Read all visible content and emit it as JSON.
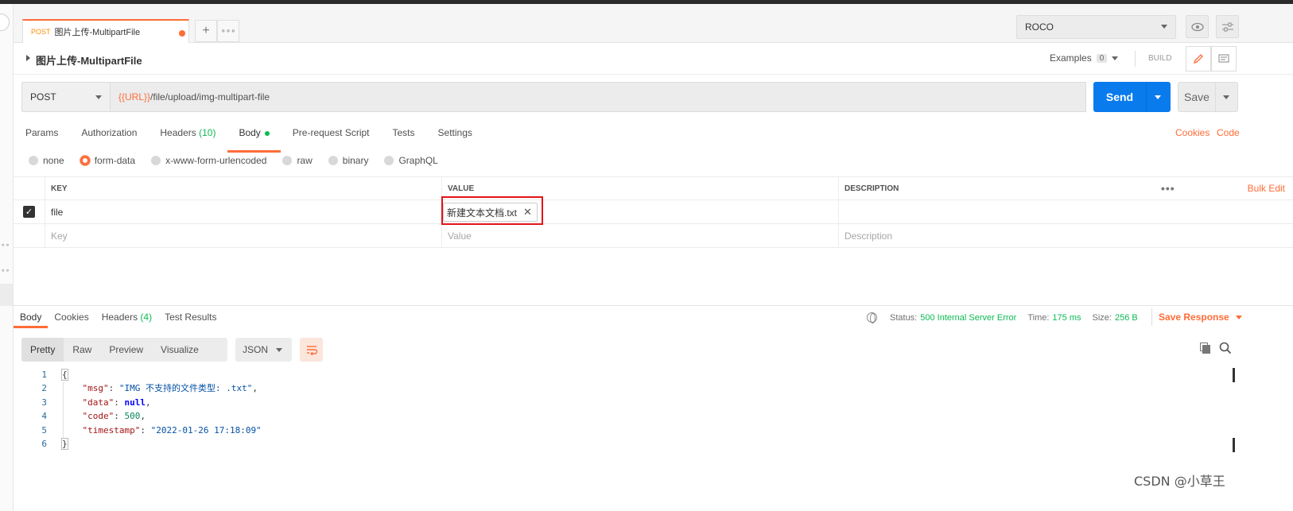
{
  "tab": {
    "method": "POST",
    "name": "图片上传-MultipartFile"
  },
  "environment": {
    "selected": "ROCO"
  },
  "request": {
    "title": "图片上传-MultipartFile",
    "examples_label": "Examples",
    "examples_count": "0",
    "build_label": "BUILD",
    "method": "POST",
    "url_var": "{{URL}}",
    "url_path": "/file/upload/img-multipart-file",
    "send_label": "Send",
    "save_label": "Save"
  },
  "request_tabs": [
    {
      "label": "Params"
    },
    {
      "label": "Authorization"
    },
    {
      "label": "Headers",
      "count": "(10)"
    },
    {
      "label": "Body"
    },
    {
      "label": "Pre-request Script"
    },
    {
      "label": "Tests"
    },
    {
      "label": "Settings"
    }
  ],
  "links": {
    "cookies": "Cookies",
    "code": "Code"
  },
  "body_types": [
    "none",
    "form-data",
    "x-www-form-urlencoded",
    "raw",
    "binary",
    "GraphQL"
  ],
  "params_table": {
    "headers": {
      "key": "KEY",
      "value": "VALUE",
      "description": "DESCRIPTION",
      "bulk_edit": "Bulk Edit"
    },
    "row": {
      "key": "file",
      "value": "新建文本文档.txt"
    },
    "placeholders": {
      "key": "Key",
      "value": "Value",
      "description": "Description"
    }
  },
  "response": {
    "tabs": [
      {
        "label": "Body"
      },
      {
        "label": "Cookies"
      },
      {
        "label": "Headers",
        "count": "(4)"
      },
      {
        "label": "Test Results"
      }
    ],
    "status_label": "Status:",
    "status_value": "500 Internal Server Error",
    "time_label": "Time:",
    "time_value": "175 ms",
    "size_label": "Size:",
    "size_value": "256 B",
    "save_response": "Save Response",
    "view_modes": [
      "Pretty",
      "Raw",
      "Preview",
      "Visualize"
    ],
    "format": "JSON",
    "line_numbers": [
      "1",
      "2",
      "3",
      "4",
      "5",
      "6"
    ],
    "json": {
      "open": "{",
      "msg_key": "\"msg\"",
      "msg_val": "\"IMG 不支持的文件类型: .txt\"",
      "data_key": "\"data\"",
      "data_val": "null",
      "code_key": "\"code\"",
      "code_val": "500",
      "ts_key": "\"timestamp\"",
      "ts_val": "\"2022-01-26 17:18:09\"",
      "close": "}"
    }
  },
  "watermark": "CSDN @小草王",
  "colors": {
    "accent": "#ff6c37",
    "send": "#097bed",
    "success": "#0cbb52"
  }
}
